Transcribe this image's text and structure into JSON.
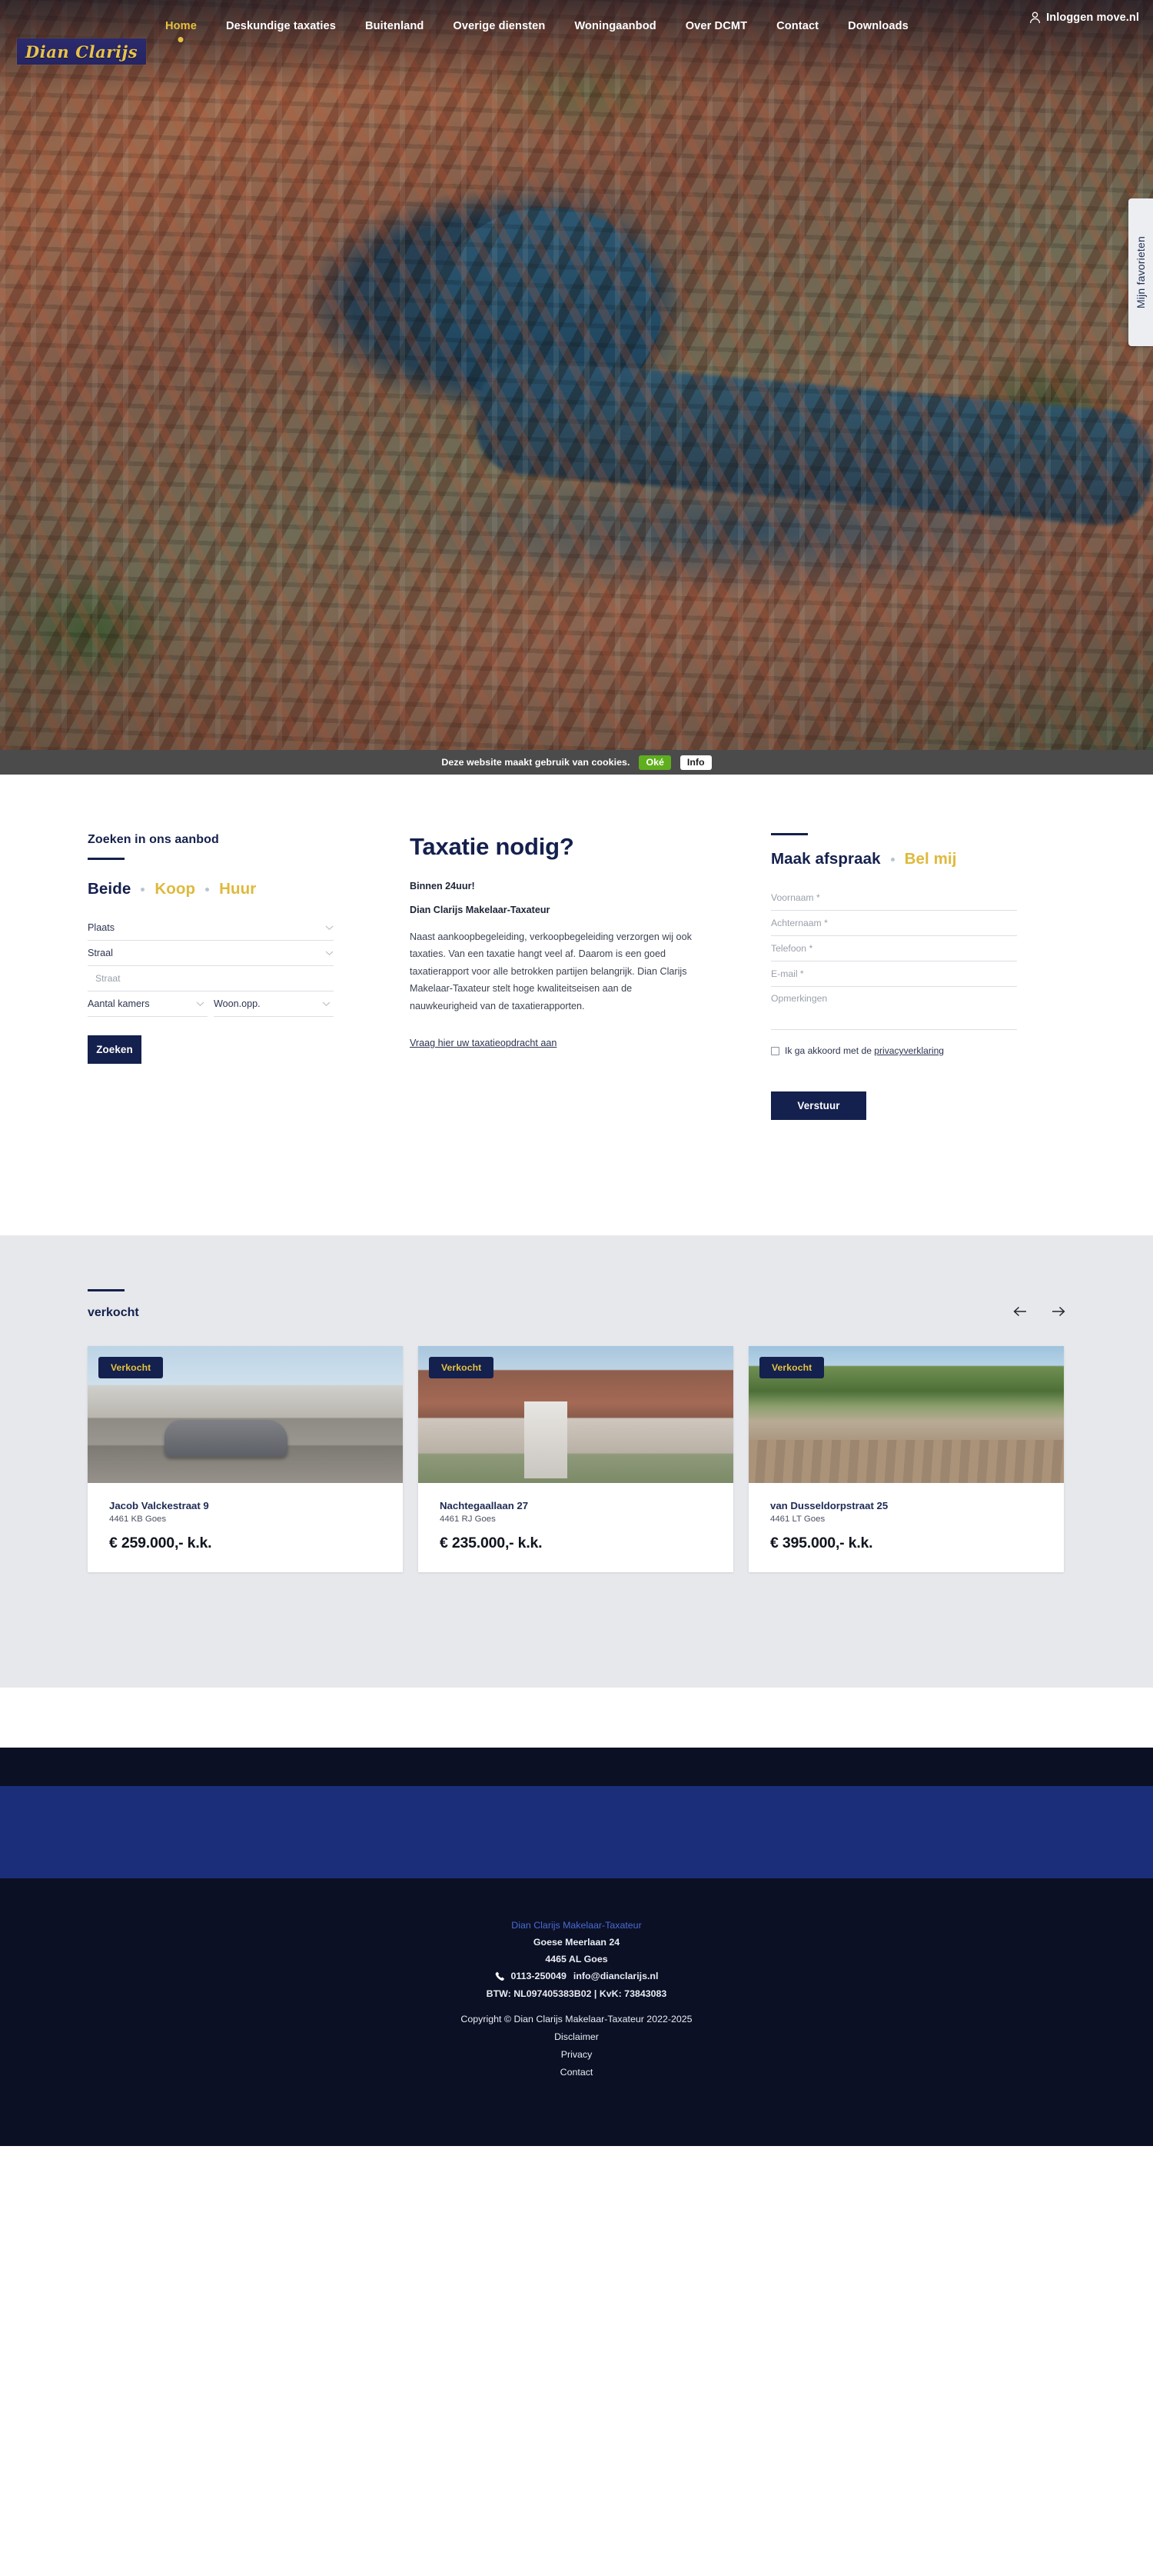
{
  "topbar": {
    "login_label": "Inloggen move.nl",
    "user_icon": "user-icon"
  },
  "logo": {
    "text": "Dian Clarijs"
  },
  "nav": {
    "items": [
      {
        "label": "Home",
        "active": true
      },
      {
        "label": "Deskundige taxaties",
        "active": false
      },
      {
        "label": "Buitenland",
        "active": false
      },
      {
        "label": "Overige diensten",
        "active": false
      },
      {
        "label": "Woningaanbod",
        "active": false
      },
      {
        "label": "Over DCMT",
        "active": false
      },
      {
        "label": "Contact",
        "active": false
      },
      {
        "label": "Downloads",
        "active": false
      }
    ]
  },
  "favorites_tab": {
    "label": "Mijn favorieten"
  },
  "cookiebar": {
    "text": "Deze website maakt gebruik van cookies.",
    "ok_label": "Oké",
    "info_label": "Info"
  },
  "search": {
    "title": "Zoeken in ons aanbod",
    "toggles": [
      {
        "label": "Beide",
        "active": true
      },
      {
        "label": "Koop",
        "active": false
      },
      {
        "label": "Huur",
        "active": false
      }
    ],
    "fields": {
      "plaats": "Plaats",
      "straal": "Straal",
      "straat_placeholder": "Straat",
      "kamers": "Aantal kamers",
      "oppervlakte": "Woon.opp."
    },
    "button_label": "Zoeken"
  },
  "taxatie": {
    "heading": "Taxatie nodig?",
    "subheading": "Binnen 24uur!",
    "lead": "Dian Clarijs Makelaar-Taxateur",
    "body": "Naast aankoopbegeleiding, verkoopbegeleiding verzorgen wij ook taxaties. Van een taxatie hangt veel af. Daarom is een goed taxatierapport voor alle betrokken partijen belangrijk. Dian Clarijs Makelaar-Taxateur stelt hoge kwaliteitseisen aan de nauwkeurigheid van de taxatierapporten.",
    "link": "Vraag hier uw taxatieopdracht aan"
  },
  "appointment": {
    "tab_primary": "Maak afspraak",
    "tab_secondary": "Bel mij",
    "fields": {
      "voornaam": "Voornaam *",
      "achternaam": "Achternaam *",
      "telefoon": "Telefoon *",
      "email": "E-mail *",
      "opmerkingen": "Opmerkingen"
    },
    "consent_text": "Ik ga akkoord met de ",
    "consent_link": "privacyverklaring",
    "submit_label": "Verstuur"
  },
  "sold": {
    "title": "verkocht",
    "prev_icon": "arrow-left-icon",
    "next_icon": "arrow-right-icon",
    "cards": [
      {
        "badge": "Verkocht",
        "street": "Jacob Valckestraat 9",
        "zip": "4461 KB Goes",
        "price": "€ 259.000,- k.k."
      },
      {
        "badge": "Verkocht",
        "street": "Nachtegaallaan 27",
        "zip": "4461 RJ Goes",
        "price": "€ 235.000,- k.k."
      },
      {
        "badge": "Verkocht",
        "street": "van Dusseldorpstraat 25",
        "zip": "4461 LT Goes",
        "price": "€ 395.000,- k.k."
      }
    ]
  },
  "footer": {
    "company": "Dian Clarijs Makelaar-Taxateur",
    "address": "Goese Meerlaan 24",
    "city": "4465 AL Goes",
    "phone": "0113-250049",
    "email": "info@dianclarijs.nl",
    "tax": "BTW: NL097405383B02 | KvK: 73843083",
    "copyright": "Copyright © Dian Clarijs Makelaar-Taxateur 2022-2025",
    "links": [
      "Disclaimer",
      "Privacy",
      "Contact"
    ]
  },
  "colors": {
    "navy": "#14204d",
    "gold": "#e5c23f",
    "footer_dark": "#0b1024",
    "footer_blue": "#1b2e7a",
    "cookie_green": "#5fae1e",
    "grey_band": "#e6e8ec"
  }
}
